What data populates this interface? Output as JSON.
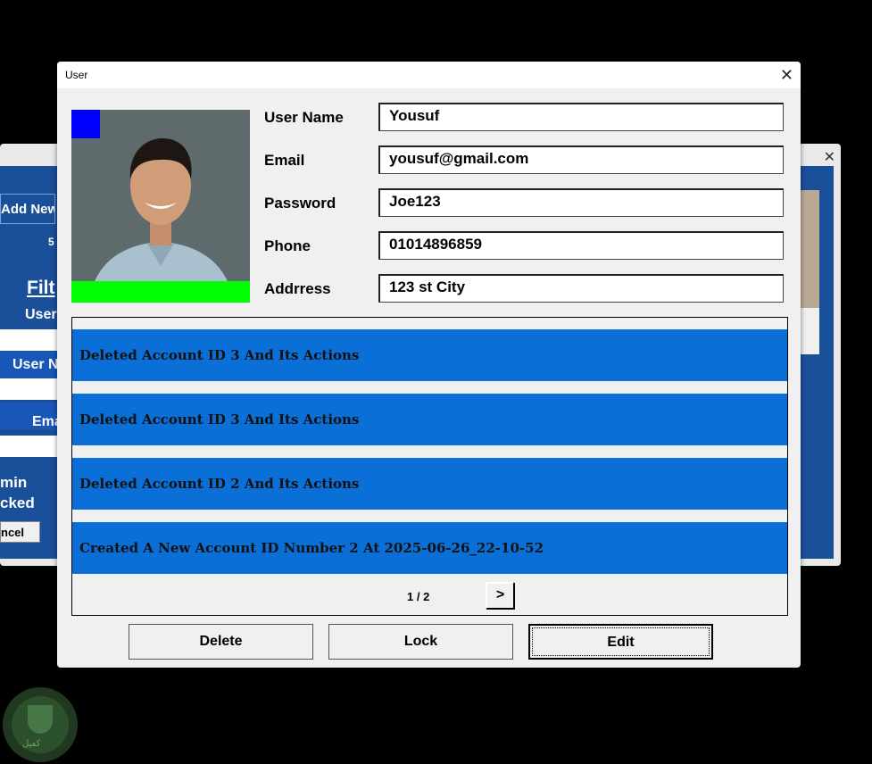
{
  "background_window": {
    "add_new_label": "Add New",
    "count_text": "5",
    "filter_heading": "Filt",
    "labels": [
      "User",
      "User N",
      "Ema"
    ],
    "checks": [
      "min",
      "cked"
    ],
    "cancel_label": "ncel",
    "close_glyph": "✕"
  },
  "dialog": {
    "title": "User",
    "close_glyph": "✕",
    "fields": [
      {
        "label": "User Name",
        "value": "Yousuf"
      },
      {
        "label": "Email",
        "value": "yousuf@gmail.com"
      },
      {
        "label": "Password",
        "value": "Joe123"
      },
      {
        "label": "Phone",
        "value": "01014896859"
      },
      {
        "label": "Addrress",
        "value": "123 st City"
      }
    ],
    "activity": [
      "Deleted Account ID 3 And Its Actions",
      "Deleted Account ID 3 And Its Actions",
      "Deleted Account ID 2 And Its Actions",
      "Created A New Account ID Number 2 At 2025-06-26_22-10-52"
    ],
    "pager": {
      "text": "1 / 2",
      "next_label": ">"
    },
    "buttons": {
      "delete": "Delete",
      "lock": "Lock",
      "edit": "Edit"
    }
  },
  "watermark": {
    "text": "كفيل"
  },
  "colors": {
    "accent": "#0a6fd6",
    "avatar_corner": "#0000ff",
    "avatar_bar": "#00ff00"
  }
}
